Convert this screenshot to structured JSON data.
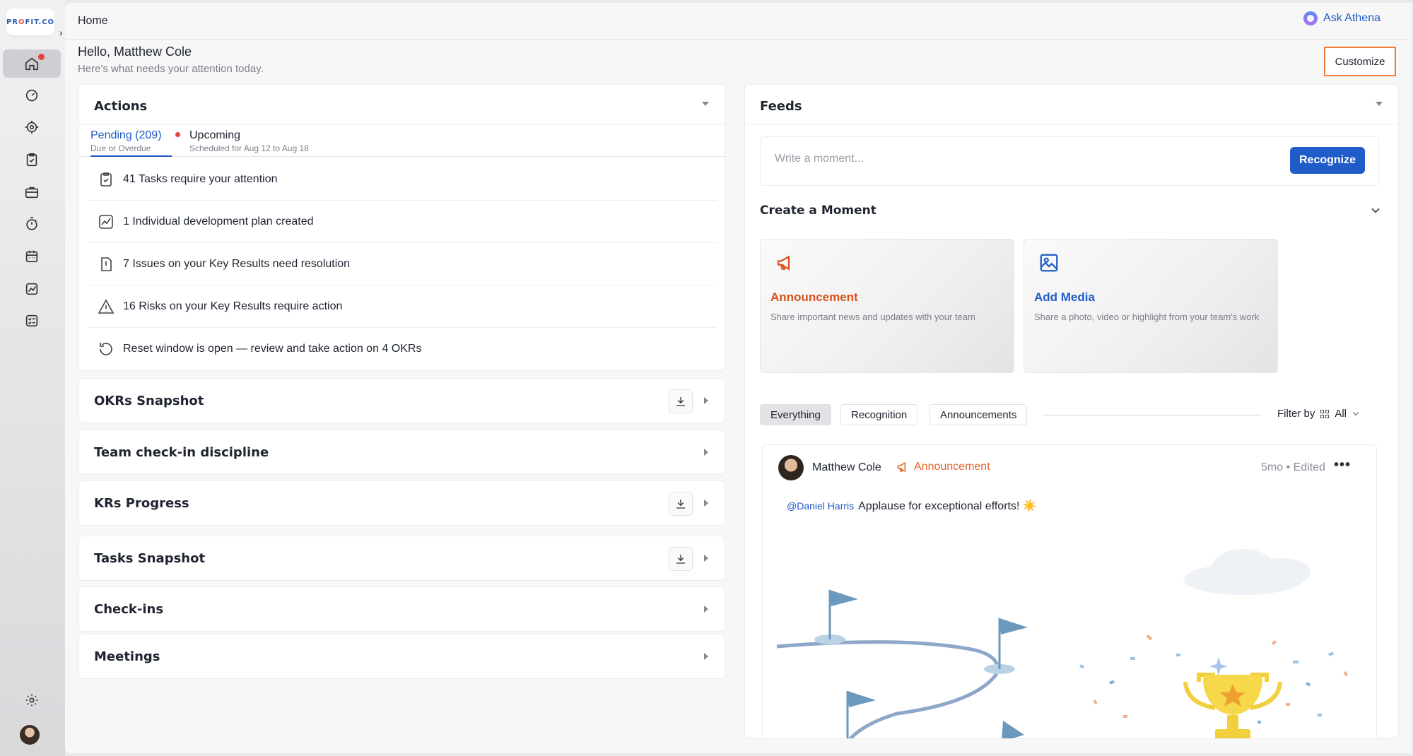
{
  "brand": {
    "logo_text_a": "PR",
    "logo_text_o": "O",
    "logo_text_b": "FIT.CO"
  },
  "header": {
    "breadcrumb": "Home",
    "ask_label": "Ask Athena"
  },
  "greeting": {
    "title": "Hello, Matthew Cole",
    "subtitle": "Here's what needs your attention today.",
    "customize_label": "Customize"
  },
  "actions": {
    "title": "Actions",
    "tabs": [
      {
        "label": "Pending (209)",
        "sub": "Due or Overdue"
      },
      {
        "label": "Upcoming",
        "sub": "Scheduled for Aug 12 to Aug 18"
      }
    ],
    "items": [
      {
        "label": "41 Tasks require your attention",
        "icon": "clipboard-check-icon"
      },
      {
        "label": "1 Individual development plan created",
        "icon": "trend-chart-icon"
      },
      {
        "label": "7 Issues on your Key Results need resolution",
        "icon": "issue-alert-icon"
      },
      {
        "label": "16 Risks on your Key Results require action",
        "icon": "warning-triangle-icon"
      },
      {
        "label": "Reset window is open — review and take action on 4 OKRs",
        "icon": "reset-icon"
      }
    ]
  },
  "sections": [
    {
      "title": "OKRs Snapshot",
      "download": true
    },
    {
      "title": "Team check-in discipline",
      "download": false
    },
    {
      "title": "KRs Progress",
      "download": true
    },
    {
      "title": "Tasks Snapshot",
      "download": true
    },
    {
      "title": "Check-ins",
      "download": false
    },
    {
      "title": "Meetings",
      "download": false
    }
  ],
  "feeds": {
    "title": "Feeds",
    "input_placeholder": "Write a moment...",
    "recognize_label": "Recognize",
    "create_title": "Create a Moment",
    "tiles": [
      {
        "title": "Announcement",
        "desc": "Share important news and updates with your team",
        "color": "#d9531e",
        "icon": "megaphone-icon"
      },
      {
        "title": "Add Media",
        "desc": "Share a photo, video or highlight from your team's work",
        "color": "#1f5cc9",
        "icon": "image-icon"
      }
    ],
    "filters": [
      "Everything",
      "Recognition",
      "Announcements"
    ],
    "filter_by_label": "Filter by",
    "filter_value": "All",
    "post": {
      "author": "Matthew Cole",
      "tag": "Announcement",
      "time": "5mo • Edited",
      "mention": "@Daniel  Harris",
      "text": "Applause for exceptional efforts! ☀️"
    }
  },
  "colors": {
    "accent": "#1f5cc9",
    "alert": "#e4423a",
    "highlight": "#f07a3a",
    "announcement": "#e2652c"
  }
}
